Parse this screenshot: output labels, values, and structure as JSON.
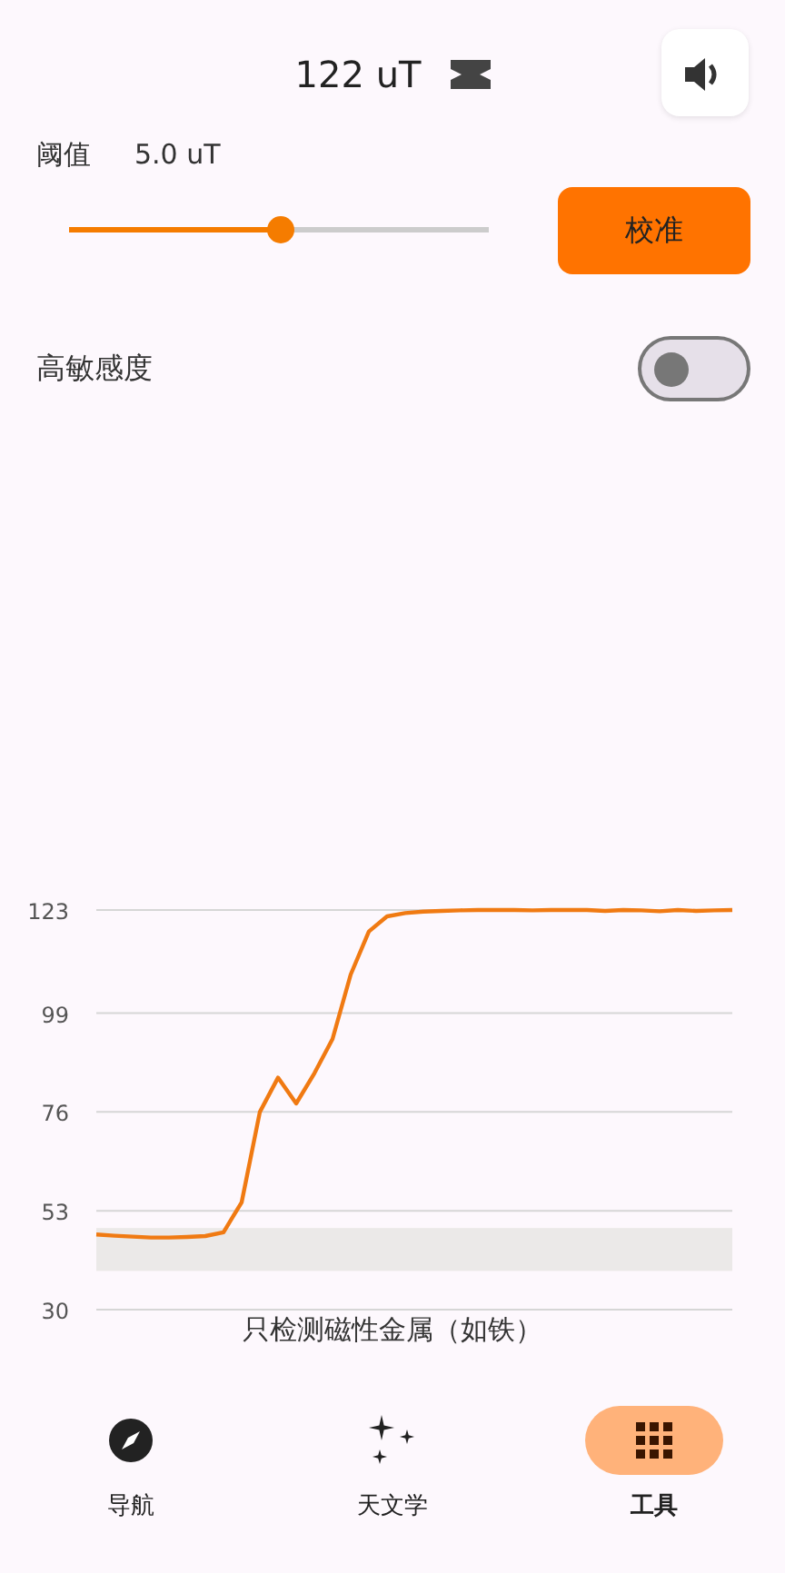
{
  "header": {
    "reading": "122 uT"
  },
  "threshold": {
    "label": "阈值",
    "value": "5.0 uT",
    "level": 0.5
  },
  "calibrate_button": "校准",
  "high_sensitivity": {
    "label": "高敏感度",
    "on": false
  },
  "chart": {
    "caption": "只检测磁性金属（如铁）",
    "chart_data": {
      "type": "line",
      "ylim": [
        30,
        123
      ],
      "yticks": [
        30,
        53,
        76,
        99,
        123
      ],
      "grid": true,
      "bands": [
        {
          "axis": "y",
          "from": 39,
          "to": 49
        }
      ],
      "series": [
        {
          "color": "#f07a12",
          "values": [
            47.5,
            47.2,
            47,
            46.8,
            46.8,
            46.9,
            47.1,
            48,
            55,
            76,
            84,
            78,
            85,
            93,
            108,
            118,
            121.5,
            122.3,
            122.6,
            122.8,
            122.9,
            123,
            123,
            123,
            122.9,
            123,
            123,
            123,
            122.8,
            123,
            122.9,
            122.7,
            123,
            122.8,
            122.9,
            123
          ]
        }
      ]
    }
  },
  "nav": [
    {
      "kind": "compass",
      "label": "导航",
      "selected": false
    },
    {
      "kind": "stars",
      "label": "天文学",
      "selected": false
    },
    {
      "kind": "grid",
      "label": "工具",
      "selected": true
    }
  ]
}
